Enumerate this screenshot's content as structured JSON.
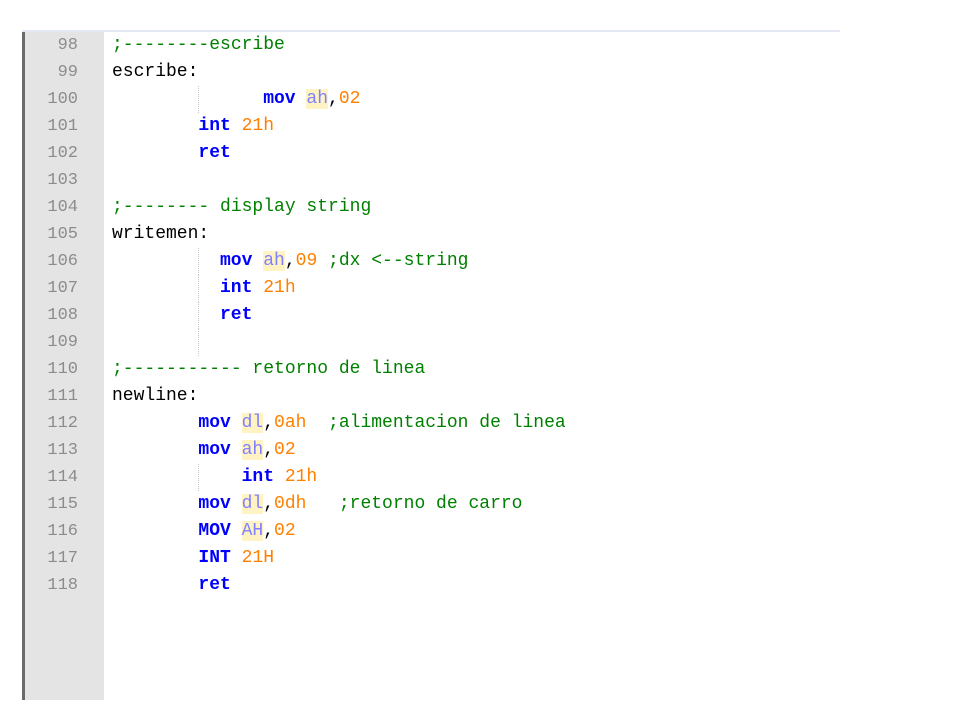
{
  "editor": {
    "lines": [
      {
        "number": "98",
        "indent": 0,
        "tokens": [
          {
            "t": ";--------escribe",
            "k": "comment"
          }
        ]
      },
      {
        "number": "99",
        "indent": 0,
        "tokens": [
          {
            "t": "escribe:",
            "k": "label"
          }
        ]
      },
      {
        "number": "100",
        "indent": 14,
        "guides": [
          8
        ],
        "tokens": [
          {
            "t": "mov",
            "k": "keyword"
          },
          {
            "t": " ",
            "k": "plain"
          },
          {
            "t": "ah",
            "k": "register"
          },
          {
            "t": ",",
            "k": "plain"
          },
          {
            "t": "02",
            "k": "number"
          }
        ]
      },
      {
        "number": "101",
        "indent": 8,
        "tokens": [
          {
            "t": "int",
            "k": "keyword"
          },
          {
            "t": " ",
            "k": "plain"
          },
          {
            "t": "21h",
            "k": "number"
          }
        ]
      },
      {
        "number": "102",
        "indent": 8,
        "tokens": [
          {
            "t": "ret",
            "k": "keyword"
          }
        ]
      },
      {
        "number": "103",
        "indent": 0,
        "tokens": []
      },
      {
        "number": "104",
        "indent": 0,
        "tokens": [
          {
            "t": ";-------- display string",
            "k": "comment"
          }
        ]
      },
      {
        "number": "105",
        "indent": 0,
        "tokens": [
          {
            "t": "writemen:",
            "k": "label"
          }
        ]
      },
      {
        "number": "106",
        "indent": 10,
        "guides": [
          8
        ],
        "tokens": [
          {
            "t": "mov",
            "k": "keyword"
          },
          {
            "t": " ",
            "k": "plain"
          },
          {
            "t": "ah",
            "k": "register"
          },
          {
            "t": ",",
            "k": "plain"
          },
          {
            "t": "09",
            "k": "number"
          },
          {
            "t": " ;dx <--string",
            "k": "comment"
          }
        ]
      },
      {
        "number": "107",
        "indent": 10,
        "guides": [
          8
        ],
        "tokens": [
          {
            "t": "int",
            "k": "keyword"
          },
          {
            "t": " ",
            "k": "plain"
          },
          {
            "t": "21h",
            "k": "number"
          }
        ]
      },
      {
        "number": "108",
        "indent": 10,
        "guides": [
          8
        ],
        "tokens": [
          {
            "t": "ret",
            "k": "keyword"
          }
        ]
      },
      {
        "number": "109",
        "indent": 0,
        "guides": [
          8
        ],
        "tokens": []
      },
      {
        "number": "110",
        "indent": 0,
        "tokens": [
          {
            "t": ";----------- retorno de linea",
            "k": "comment"
          }
        ]
      },
      {
        "number": "111",
        "indent": 0,
        "tokens": [
          {
            "t": "newline:",
            "k": "label"
          }
        ]
      },
      {
        "number": "112",
        "indent": 8,
        "tokens": [
          {
            "t": "mov",
            "k": "keyword"
          },
          {
            "t": " ",
            "k": "plain"
          },
          {
            "t": "dl",
            "k": "register"
          },
          {
            "t": ",",
            "k": "plain"
          },
          {
            "t": "0ah",
            "k": "number"
          },
          {
            "t": "  ;alimentacion de linea",
            "k": "comment"
          }
        ]
      },
      {
        "number": "113",
        "indent": 8,
        "tokens": [
          {
            "t": "mov",
            "k": "keyword"
          },
          {
            "t": " ",
            "k": "plain"
          },
          {
            "t": "ah",
            "k": "register"
          },
          {
            "t": ",",
            "k": "plain"
          },
          {
            "t": "02",
            "k": "number"
          }
        ]
      },
      {
        "number": "114",
        "indent": 12,
        "guides": [
          8
        ],
        "tokens": [
          {
            "t": "int",
            "k": "keyword"
          },
          {
            "t": " ",
            "k": "plain"
          },
          {
            "t": "21h",
            "k": "number"
          }
        ]
      },
      {
        "number": "115",
        "indent": 8,
        "tokens": [
          {
            "t": "mov",
            "k": "keyword"
          },
          {
            "t": " ",
            "k": "plain"
          },
          {
            "t": "dl",
            "k": "register"
          },
          {
            "t": ",",
            "k": "plain"
          },
          {
            "t": "0dh",
            "k": "number"
          },
          {
            "t": "   ;retorno de carro",
            "k": "comment"
          }
        ]
      },
      {
        "number": "116",
        "indent": 8,
        "tokens": [
          {
            "t": "MOV",
            "k": "keyword"
          },
          {
            "t": " ",
            "k": "plain"
          },
          {
            "t": "AH",
            "k": "register"
          },
          {
            "t": ",",
            "k": "plain"
          },
          {
            "t": "02",
            "k": "number"
          }
        ]
      },
      {
        "number": "117",
        "indent": 8,
        "tokens": [
          {
            "t": "INT",
            "k": "keyword"
          },
          {
            "t": " ",
            "k": "plain"
          },
          {
            "t": "21H",
            "k": "number"
          }
        ]
      },
      {
        "number": "118",
        "indent": 8,
        "tokens": [
          {
            "t": "ret",
            "k": "keyword"
          }
        ]
      }
    ]
  },
  "colors": {
    "comment": "#008000",
    "keyword": "#0000ff",
    "register": "#8080ff",
    "register_highlight": "#fff3c4",
    "number": "#ff8000",
    "line_number": "#8c8c8c",
    "gutter_background": "#e4e4e4"
  }
}
